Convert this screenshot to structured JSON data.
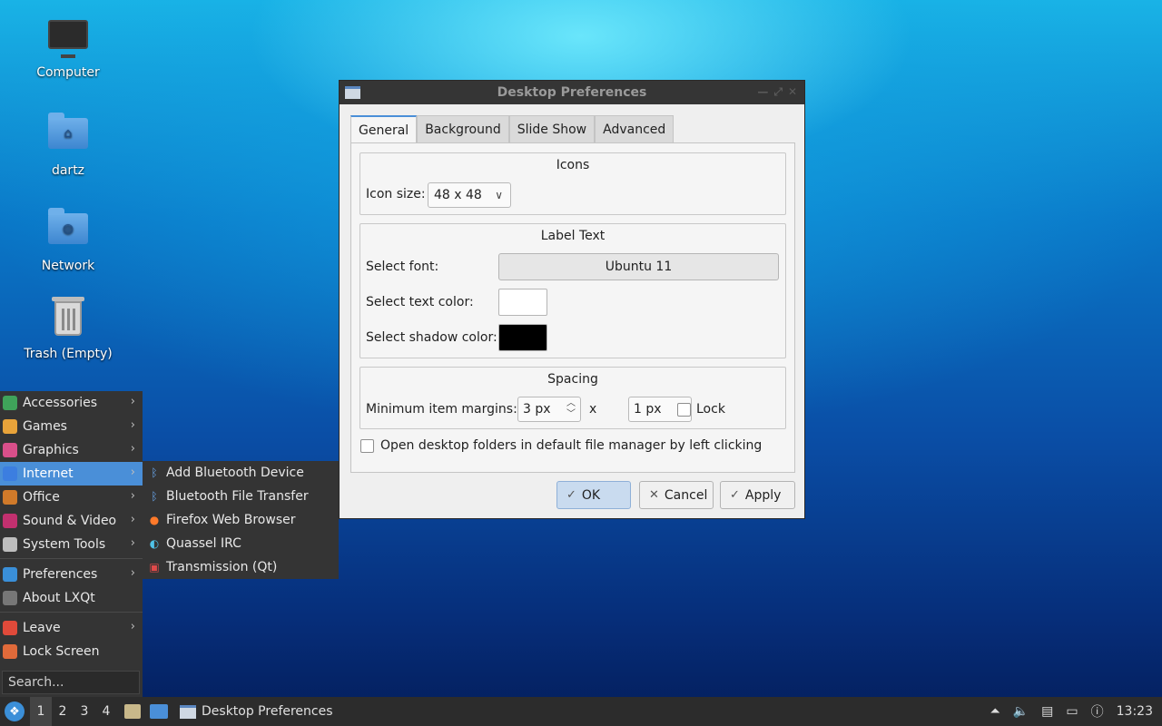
{
  "desktop": {
    "icons": [
      {
        "label": "Computer"
      },
      {
        "label": "dartz"
      },
      {
        "label": "Network"
      },
      {
        "label": "Trash (Empty)"
      }
    ]
  },
  "dialog": {
    "title": "Desktop Preferences",
    "tabs": [
      "General",
      "Background",
      "Slide Show",
      "Advanced"
    ],
    "active_tab": "General",
    "icons_group": {
      "title": "Icons",
      "icon_size_label": "Icon size:",
      "icon_size_value": "48 x 48"
    },
    "label_group": {
      "title": "Label Text",
      "font_label": "Select font:",
      "font_value": "Ubuntu 11",
      "text_color_label": "Select text color:",
      "text_color": "#ffffff",
      "shadow_color_label": "Select shadow color:",
      "shadow_color": "#000000"
    },
    "spacing_group": {
      "title": "Spacing",
      "margins_label": "Minimum item margins:",
      "margin_x": "3 px",
      "times": "x",
      "margin_y": "1 px",
      "lock_label": "Lock",
      "lock_checked": false
    },
    "open_folders_label": "Open desktop folders in default file manager by left clicking",
    "open_folders_checked": false,
    "buttons": {
      "ok": "OK",
      "cancel": "Cancel",
      "apply": "Apply"
    }
  },
  "menu": {
    "items": [
      {
        "label": "Accessories",
        "color": "#3fa35a"
      },
      {
        "label": "Games",
        "color": "#e8a33a"
      },
      {
        "label": "Graphics",
        "color": "#d94f8a"
      },
      {
        "label": "Internet",
        "color": "#3c7ee0"
      },
      {
        "label": "Office",
        "color": "#d07a2a"
      },
      {
        "label": "Sound & Video",
        "color": "#c2306f"
      },
      {
        "label": "System Tools",
        "color": "#bdbdbd"
      },
      {
        "label": "Preferences",
        "color": "#3a8fd8"
      },
      {
        "label": "About LXQt",
        "color": "#777777"
      },
      {
        "label": "Leave",
        "color": "#e04a3a"
      },
      {
        "label": "Lock Screen",
        "color": "#e06a3a"
      }
    ],
    "search_placeholder": "Search...",
    "submenu": [
      {
        "label": "Add Bluetooth Device"
      },
      {
        "label": "Bluetooth File Transfer"
      },
      {
        "label": "Firefox Web Browser"
      },
      {
        "label": "Quassel IRC"
      },
      {
        "label": "Transmission (Qt)"
      }
    ]
  },
  "taskbar": {
    "desktops": [
      "1",
      "2",
      "3",
      "4"
    ],
    "task_title": "Desktop Preferences",
    "clock": "13:23"
  }
}
